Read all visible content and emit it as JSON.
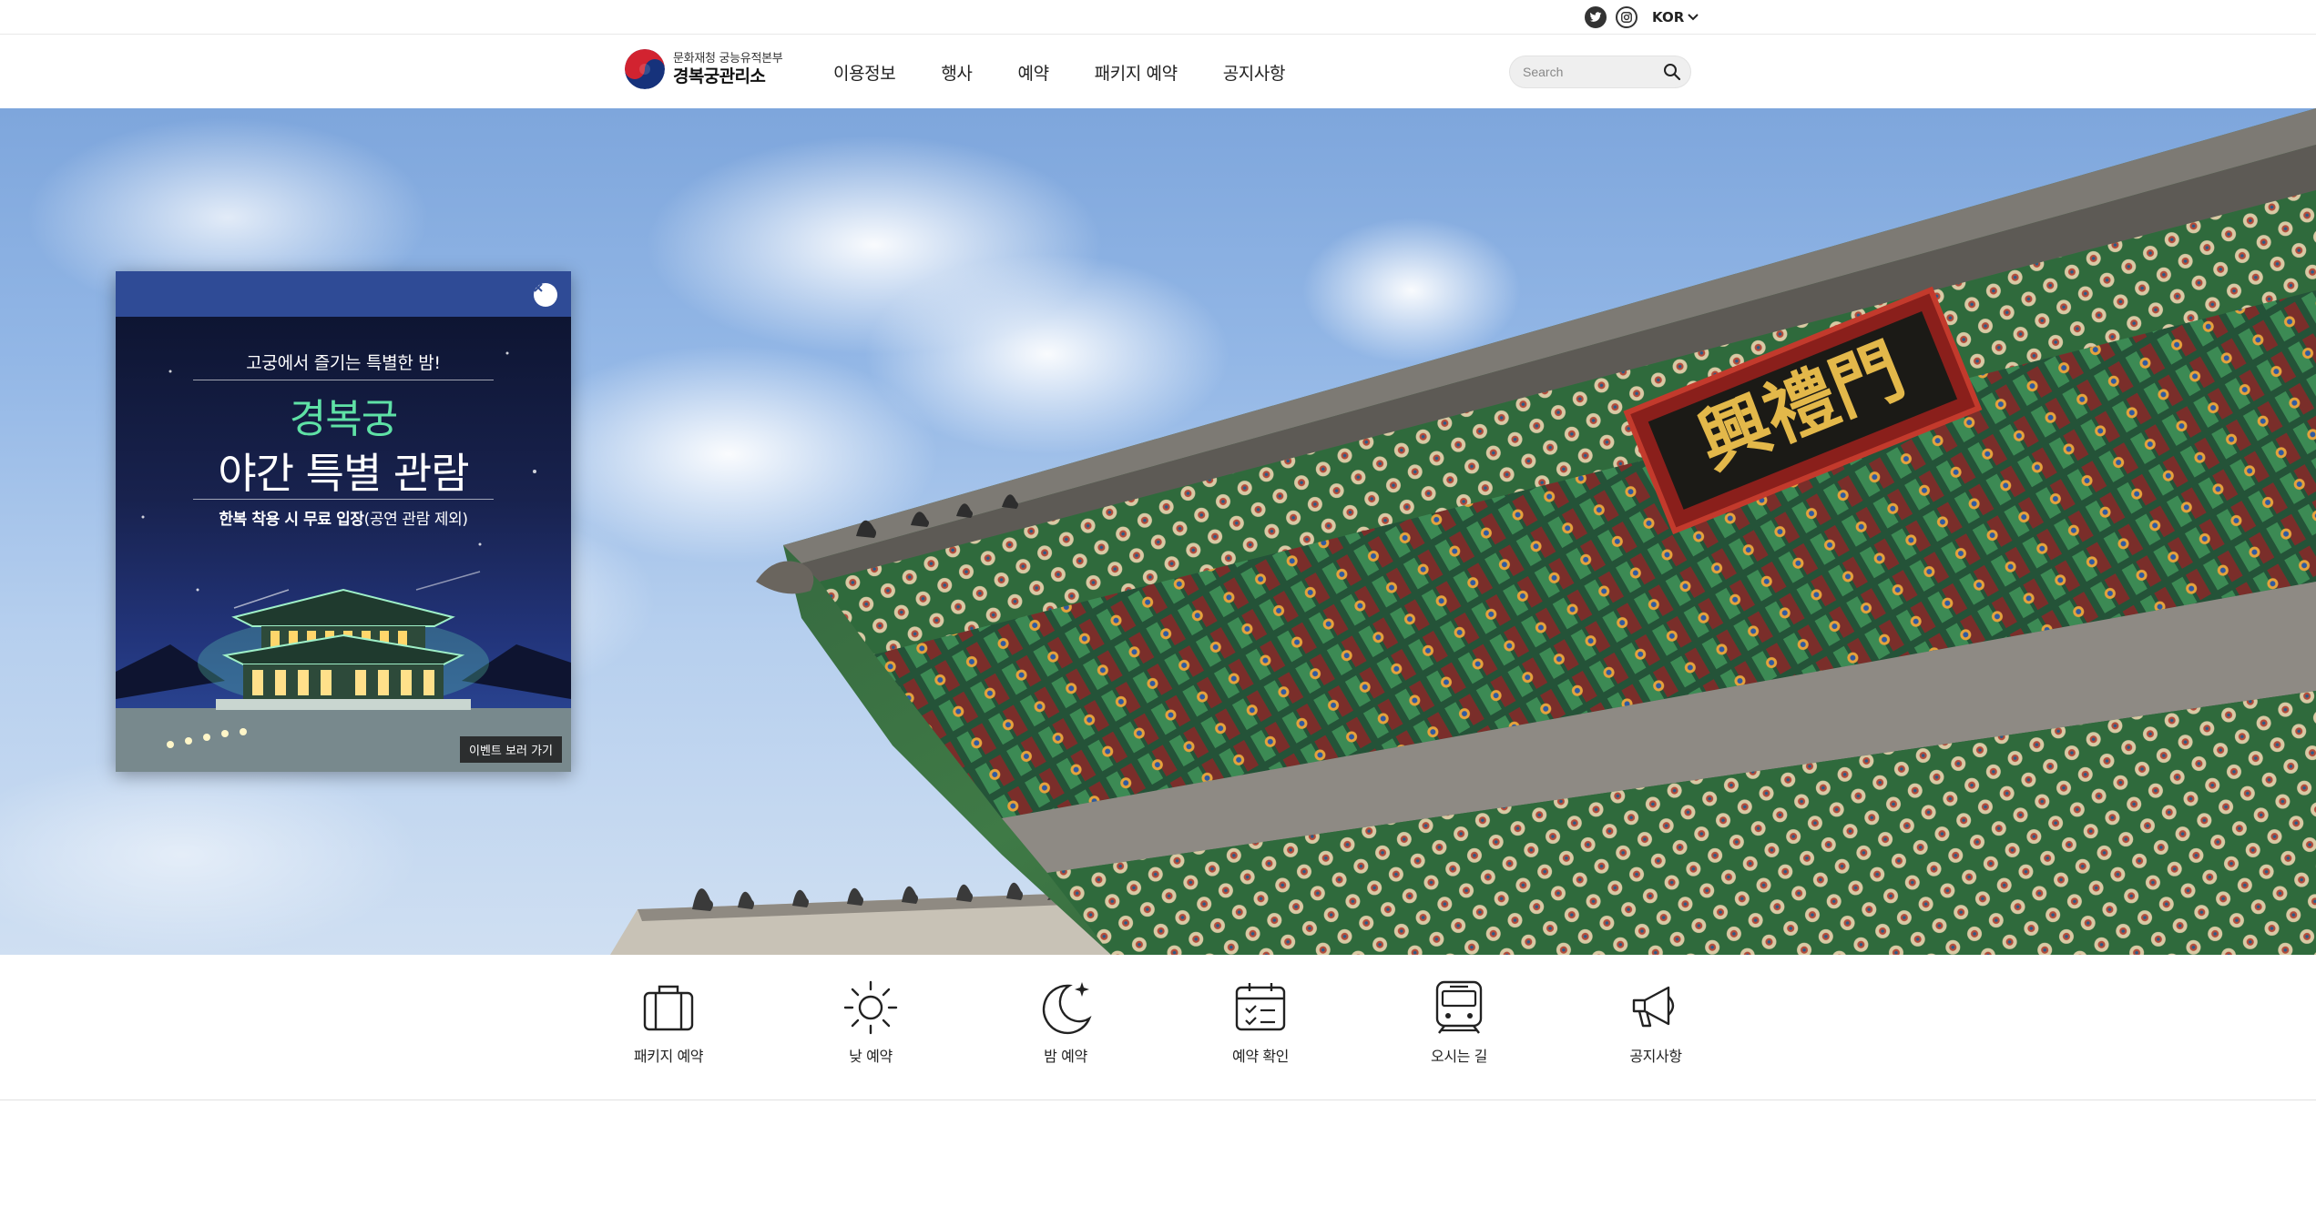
{
  "util": {
    "language": "KOR",
    "icons": [
      "twitter-icon",
      "instagram-icon",
      "chevron-down-icon"
    ]
  },
  "header": {
    "logo_line1": "문화재청 궁능유적본부",
    "logo_line2": "경복궁관리소",
    "nav": [
      "이용정보",
      "행사",
      "예약",
      "패키지 예약",
      "공지사항"
    ],
    "search_placeholder": "Search"
  },
  "hero": {
    "signboard_text": "興禮門"
  },
  "popup": {
    "subtitle": "고궁에서 즐기는 특별한 밤!",
    "title_line1": "경복궁",
    "title_line2": "야간 특별 관람",
    "note_bold": "한복 착용 시 무료 입장",
    "note_rest": "(공연 관람 제외)",
    "button": "이벤트 보러 가기",
    "colors": {
      "header": "#2f4b96",
      "accent": "#5fe2a6"
    }
  },
  "quick_menu": [
    {
      "label": "패키지 예약",
      "icon": "suitcase-icon"
    },
    {
      "label": "낮 예약",
      "icon": "sun-icon"
    },
    {
      "label": "밤 예약",
      "icon": "moon-icon"
    },
    {
      "label": "예약 확인",
      "icon": "calendar-check-icon"
    },
    {
      "label": "오시는 길",
      "icon": "train-icon"
    },
    {
      "label": "공지사항",
      "icon": "megaphone-icon"
    }
  ]
}
